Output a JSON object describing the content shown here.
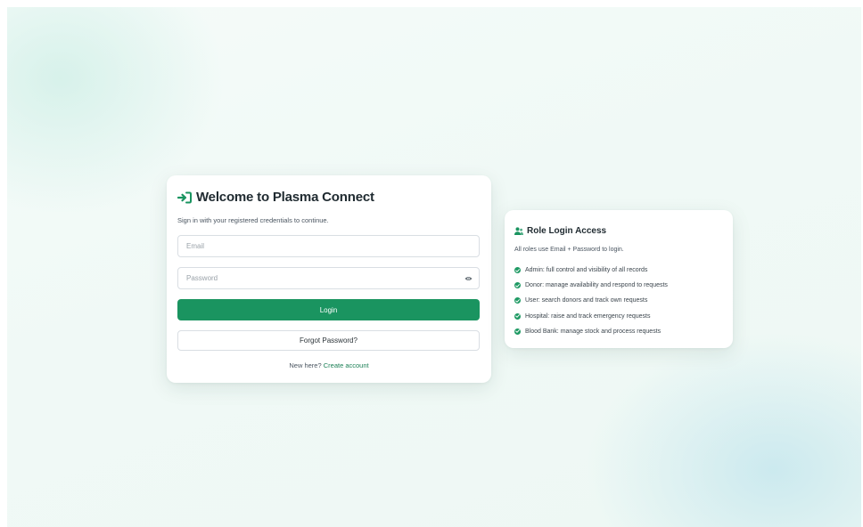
{
  "login": {
    "title": "Welcome to Plasma Connect",
    "subtitle": "Sign in with your registered credentials to continue.",
    "email_placeholder": "Email",
    "password_placeholder": "Password",
    "login_label": "Login",
    "forgot_label": "Forgot Password?",
    "signup_prompt": "New here?",
    "signup_link": "Create account",
    "icon": "sign-in-icon",
    "accent": "#1a9460"
  },
  "roles": {
    "title": "Role Login Access",
    "icon": "users-icon",
    "description": "All roles use Email + Password to login.",
    "items": [
      "Admin: full control and visibility of all records",
      "Donor: manage availability and respond to requests",
      "User: search donors and track own requests",
      "Hospital: raise and track emergency requests",
      "Blood Bank: manage stock and process requests"
    ],
    "check_color": "#1f9a64"
  }
}
